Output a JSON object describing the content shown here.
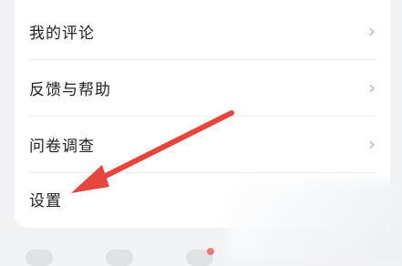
{
  "menu": {
    "items": [
      {
        "label": "我的评论",
        "chevron": "›",
        "has_chevron": true
      },
      {
        "label": "反馈与帮助",
        "chevron": "›",
        "has_chevron": true
      },
      {
        "label": "问卷调查",
        "chevron": "›",
        "has_chevron": true
      },
      {
        "label": "设置",
        "has_chevron": false
      }
    ]
  },
  "annotation": {
    "icon": "red-arrow-icon",
    "color": "#e8453c"
  },
  "icons": {
    "chevron": "chevron-right-icon"
  }
}
